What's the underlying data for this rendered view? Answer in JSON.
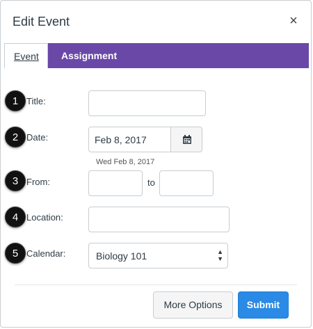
{
  "dialog": {
    "title": "Edit Event",
    "close_glyph": "×"
  },
  "tabs": [
    {
      "label": "Event",
      "active": true
    },
    {
      "label": "Assignment",
      "active": false
    }
  ],
  "form": {
    "title_label": "Title:",
    "title_value": "",
    "date_label": "Date:",
    "date_value": "Feb 8, 2017",
    "date_hint": "Wed Feb 8, 2017",
    "from_label": "From:",
    "from_value": "",
    "to_label": "to",
    "to_value": "",
    "location_label": "Location:",
    "location_value": "",
    "calendar_label": "Calendar:",
    "calendar_value": "Biology 101"
  },
  "callouts": [
    "1",
    "2",
    "3",
    "4",
    "5"
  ],
  "buttons": {
    "more_options": "More Options",
    "submit": "Submit"
  },
  "icons": {
    "calendar": "calendar-icon",
    "close": "close-icon",
    "select": "select-arrows-icon"
  },
  "colors": {
    "tab_bar": "#6a48a8",
    "submit": "#2a8ae6",
    "callout": "#111111"
  }
}
